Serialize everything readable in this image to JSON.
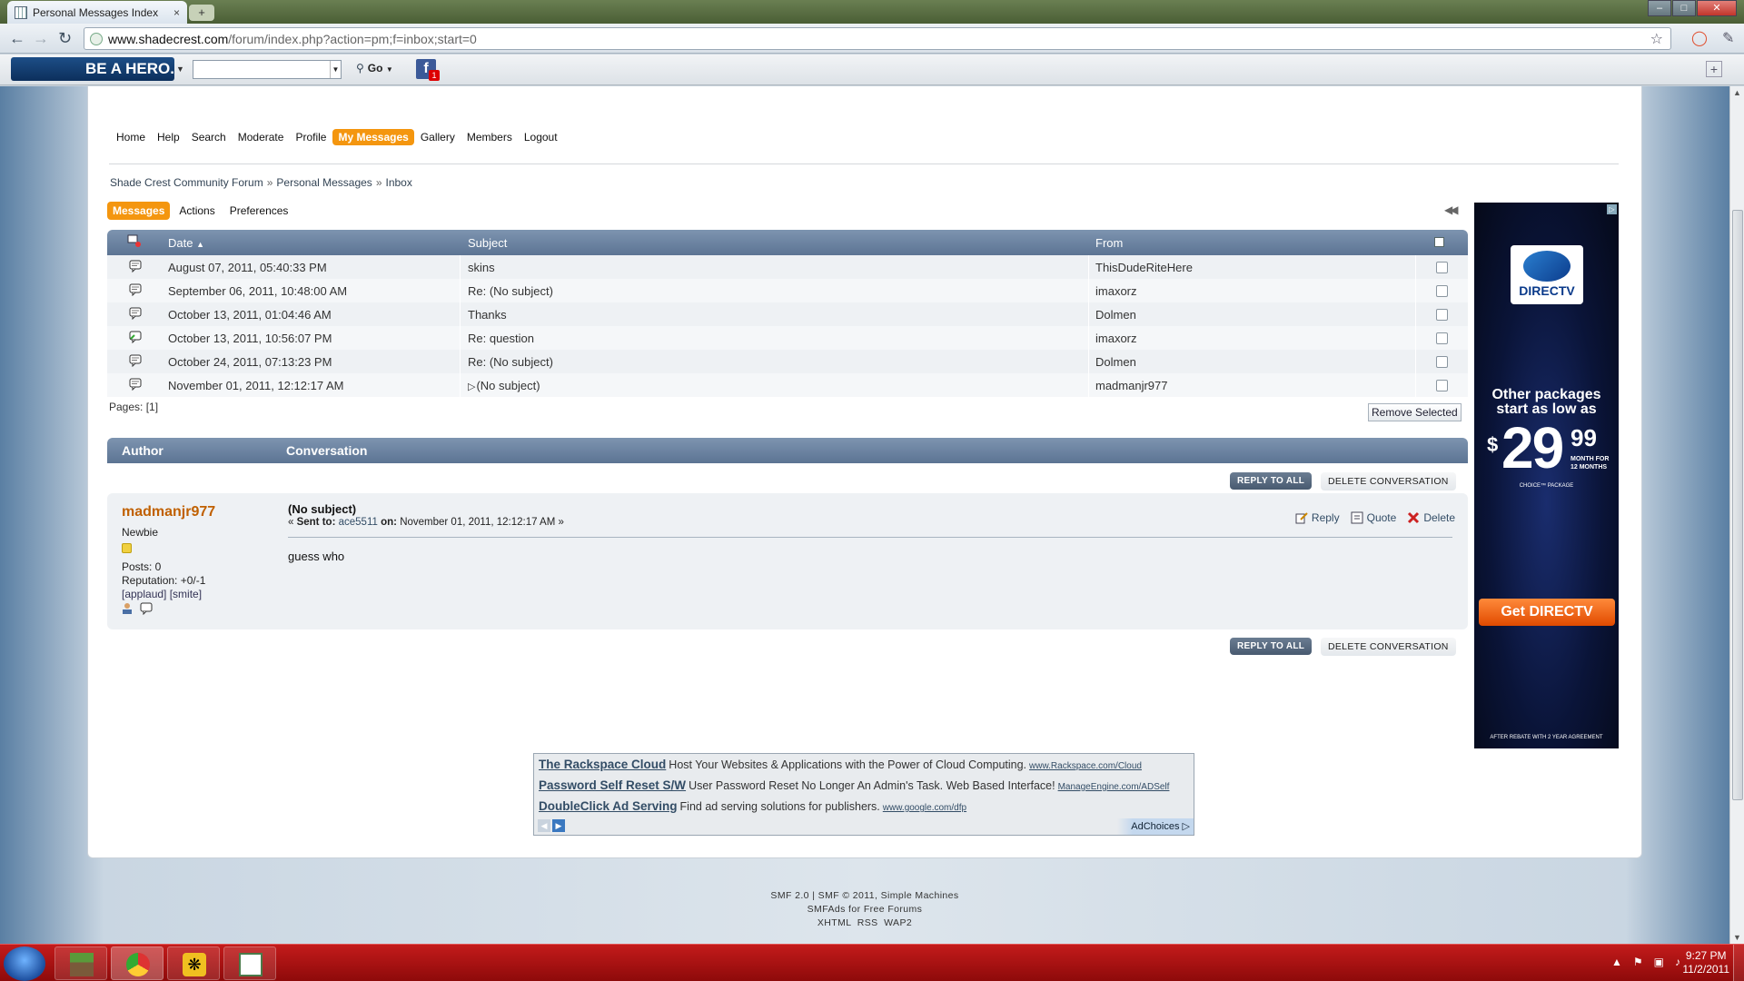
{
  "browser": {
    "tab_title": "Personal Messages Index",
    "tab_close": "×",
    "new_tab": "+",
    "window_buttons": [
      "–",
      "□",
      "✕"
    ],
    "url_host": "www.shadecrest.com",
    "url_path": "/forum/index.php?action=pm;f=inbox;start=0"
  },
  "addon_toolbar": {
    "brand_text": "BE A HERO.",
    "go_label": "Go",
    "fb_badge": "1"
  },
  "main_menu": [
    {
      "label": "Home",
      "active": false
    },
    {
      "label": "Help",
      "active": false
    },
    {
      "label": "Search",
      "active": false
    },
    {
      "label": "Moderate",
      "active": false
    },
    {
      "label": "Profile",
      "active": false
    },
    {
      "label": "My Messages",
      "active": true
    },
    {
      "label": "Gallery",
      "active": false
    },
    {
      "label": "Members",
      "active": false
    },
    {
      "label": "Logout",
      "active": false
    }
  ],
  "breadcrumb": [
    "Shade Crest Community Forum",
    "Personal Messages",
    "Inbox"
  ],
  "breadcrumb_sep": "»",
  "subtabs": [
    {
      "label": "Messages",
      "active": true
    },
    {
      "label": "Actions",
      "active": false
    },
    {
      "label": "Preferences",
      "active": false
    }
  ],
  "pm_table": {
    "headers": {
      "date": "Date",
      "sort_arrow": "▲",
      "subject": "Subject",
      "from": "From"
    },
    "rows": [
      {
        "date": "August 07, 2011, 05:40:33 PM",
        "subject": "skins",
        "from": "ThisDudeRiteHere",
        "replied": false,
        "current": false
      },
      {
        "date": "September 06, 2011, 10:48:00 AM",
        "subject": "Re: (No subject)",
        "from": "imaxorz",
        "replied": false,
        "current": false
      },
      {
        "date": "October 13, 2011, 01:04:46 AM",
        "subject": "Thanks",
        "from": "Dolmen",
        "replied": false,
        "current": false
      },
      {
        "date": "October 13, 2011, 10:56:07 PM",
        "subject": "Re: question",
        "from": "imaxorz",
        "replied": true,
        "current": false
      },
      {
        "date": "October 24, 2011, 07:13:23 PM",
        "subject": "Re: (No subject)",
        "from": "Dolmen",
        "replied": false,
        "current": false
      },
      {
        "date": "November 01, 2011, 12:12:17 AM",
        "subject": "(No subject)",
        "from": "madmanjr977",
        "replied": false,
        "current": true
      }
    ]
  },
  "pages_label": "Pages: [1]",
  "remove_selected": "Remove Selected",
  "conversation": {
    "col_author": "Author",
    "col_conversation": "Conversation",
    "reply_all": "REPLY TO ALL",
    "delete_conv": "DELETE CONVERSATION"
  },
  "post": {
    "author": "madmanjr977",
    "rank": "Newbie",
    "posts": "Posts: 0",
    "reputation": "Reputation: +0/-1",
    "karma_links": "[applaud] [smite]",
    "subject": "(No subject)",
    "meta_prefix": "« ",
    "sent_to_label": "Sent to:",
    "sent_to": "ace5511",
    "on_label": "on:",
    "date": "November 01, 2011, 12:12:17 AM",
    "meta_suffix": " »",
    "body": "guess who",
    "actions": [
      "Reply",
      "Quote",
      "Delete"
    ]
  },
  "ad_right": {
    "logo": "DIRECTV",
    "line1": "Other packages",
    "line2": "start as low as",
    "dollar": "$",
    "price": "29",
    "cents": "99",
    "per1": "MONTH FOR",
    "per2": "12 MONTHS",
    "choice": "CHOICE™ PACKAGE",
    "cta": "Get DIRECTV",
    "fine": "AFTER REBATE WITH 2 YEAR AGREEMENT"
  },
  "ad_bottom": [
    {
      "title": "The Rackspace Cloud",
      "text": "Host Your Websites & Applications with the Power of Cloud Computing.",
      "url": "www.Rackspace.com/Cloud"
    },
    {
      "title": "Password Self Reset S/W",
      "text": "User Password Reset No Longer An Admin's Task. Web Based Interface!",
      "url": "ManageEngine.com/ADSelf"
    },
    {
      "title": "DoubleClick Ad Serving",
      "text": "Find ad serving solutions for publishers.",
      "url": "www.google.com/dfp"
    }
  ],
  "adchoices": "AdChoices ▷",
  "footer": {
    "line1": "SMF 2.0 | SMF © 2011, Simple Machines",
    "line2": "SMFAds for Free Forums",
    "line3": "XHTML  RSS  WAP2"
  },
  "taskbar": {
    "time": "9:27 PM",
    "date": "11/2/2011"
  },
  "colors": {
    "accent": "#f4960f",
    "header_blue": "#5c7493",
    "author_orange": "#c06000",
    "taskbar_red": "#b01414"
  }
}
